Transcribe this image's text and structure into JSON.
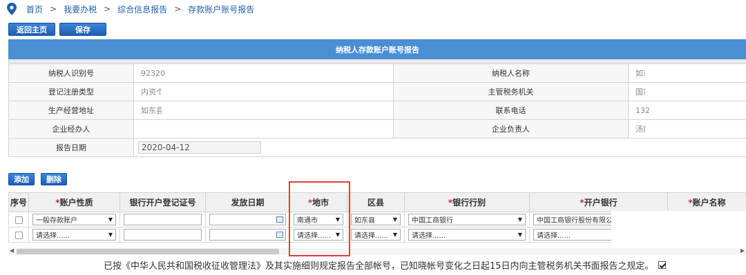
{
  "breadcrumb": {
    "items": [
      "首页",
      "我要办税",
      "综合信息报告",
      "存款账户账号报告"
    ],
    "separator": ">"
  },
  "toolbar": {
    "back_label": "返回主页",
    "save_label": "保存"
  },
  "report": {
    "title": "纳税人存款账户账号报告",
    "taxpayer_id_label": "纳税人识别号",
    "taxpayer_id_value": "92320",
    "taxpayer_name_label": "纳税人名称",
    "taxpayer_name_value": "如东",
    "reg_type_label": "登记注册类型",
    "reg_type_value": "内资个",
    "tax_authority_label": "主管税务机关",
    "tax_authority_value": "国家",
    "address_label": "生产经营地址",
    "address_value": "如东县",
    "phone_label": "联系电话",
    "phone_value": "132",
    "agent_label": "企业经办人",
    "agent_value": "",
    "owner_label": "企业负责人",
    "owner_value": "汤新",
    "date_label": "报告日期",
    "date_value": "2020-04-12"
  },
  "actions": {
    "add_label": "添加",
    "delete_label": "删除"
  },
  "grid": {
    "headers": {
      "index": "序号",
      "account_type": "账户性质",
      "license_no": "银行开户登记证号",
      "issue_date": "发放日期",
      "city": "地市",
      "district": "区县",
      "bank": "银行行别",
      "branch": "开户银行",
      "account_name": "账户名称"
    },
    "required_mark": "*",
    "rows": [
      {
        "account_type": "一般存款账户",
        "city": "南通市",
        "district": "如东县",
        "bank": "中国工商银行",
        "branch": "中国工商银行股份有限公"
      },
      {
        "account_type": "请选择......",
        "city": "请选择......",
        "district": "请选择......",
        "bank": "请选择......",
        "branch": "请选择......"
      }
    ]
  },
  "notice": "已按《中华人民共和国税收征收管理法》及其实施细则规定报告全部帐号，已知晓帐号变化之日起15日内向主管税务机关书面报告之规定。",
  "colors": {
    "header_blue": "#4a8fd4",
    "button_blue": "#2a6fc4",
    "highlight_red": "#e53b3b"
  }
}
